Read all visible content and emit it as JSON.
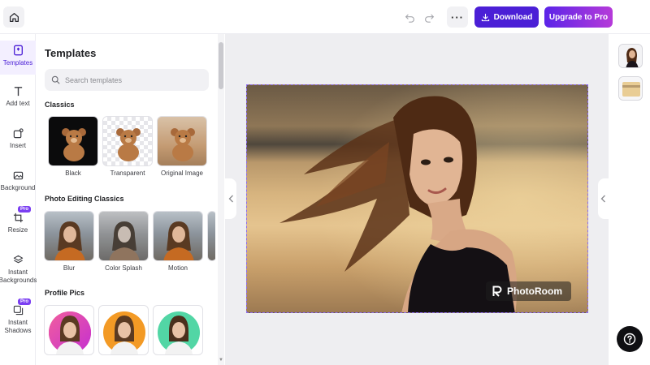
{
  "toolbar": {
    "download_label": "Download",
    "upgrade_label": "Upgrade to Pro",
    "more_label": "···"
  },
  "rail": {
    "items": [
      {
        "label": "Templates"
      },
      {
        "label": "Add text"
      },
      {
        "label": "Insert"
      },
      {
        "label": "Background"
      },
      {
        "label": "Resize",
        "badge": "Pro"
      },
      {
        "label": "Instant\nBackgrounds"
      },
      {
        "label": "Instant\nShadows",
        "badge": "Pro"
      }
    ]
  },
  "panel": {
    "title": "Templates",
    "search_placeholder": "Search templates",
    "sections": [
      {
        "title": "Classics",
        "cards": [
          {
            "label": "Black"
          },
          {
            "label": "Transparent"
          },
          {
            "label": "Original Image"
          }
        ]
      },
      {
        "title": "Photo Editing Classics",
        "cards": [
          {
            "label": "Blur"
          },
          {
            "label": "Color Splash"
          },
          {
            "label": "Motion"
          }
        ]
      },
      {
        "title": "Profile Pics",
        "cards": [
          {
            "label": ""
          },
          {
            "label": ""
          },
          {
            "label": ""
          }
        ]
      }
    ]
  },
  "canvas": {
    "watermark": "PhotoRoom"
  },
  "colors": {
    "accent": "#4b1fd6",
    "upgrade_gradient_start": "#5b24e8",
    "upgrade_gradient_end": "#b63ad9",
    "canvas_bg": "#eeeef1"
  }
}
